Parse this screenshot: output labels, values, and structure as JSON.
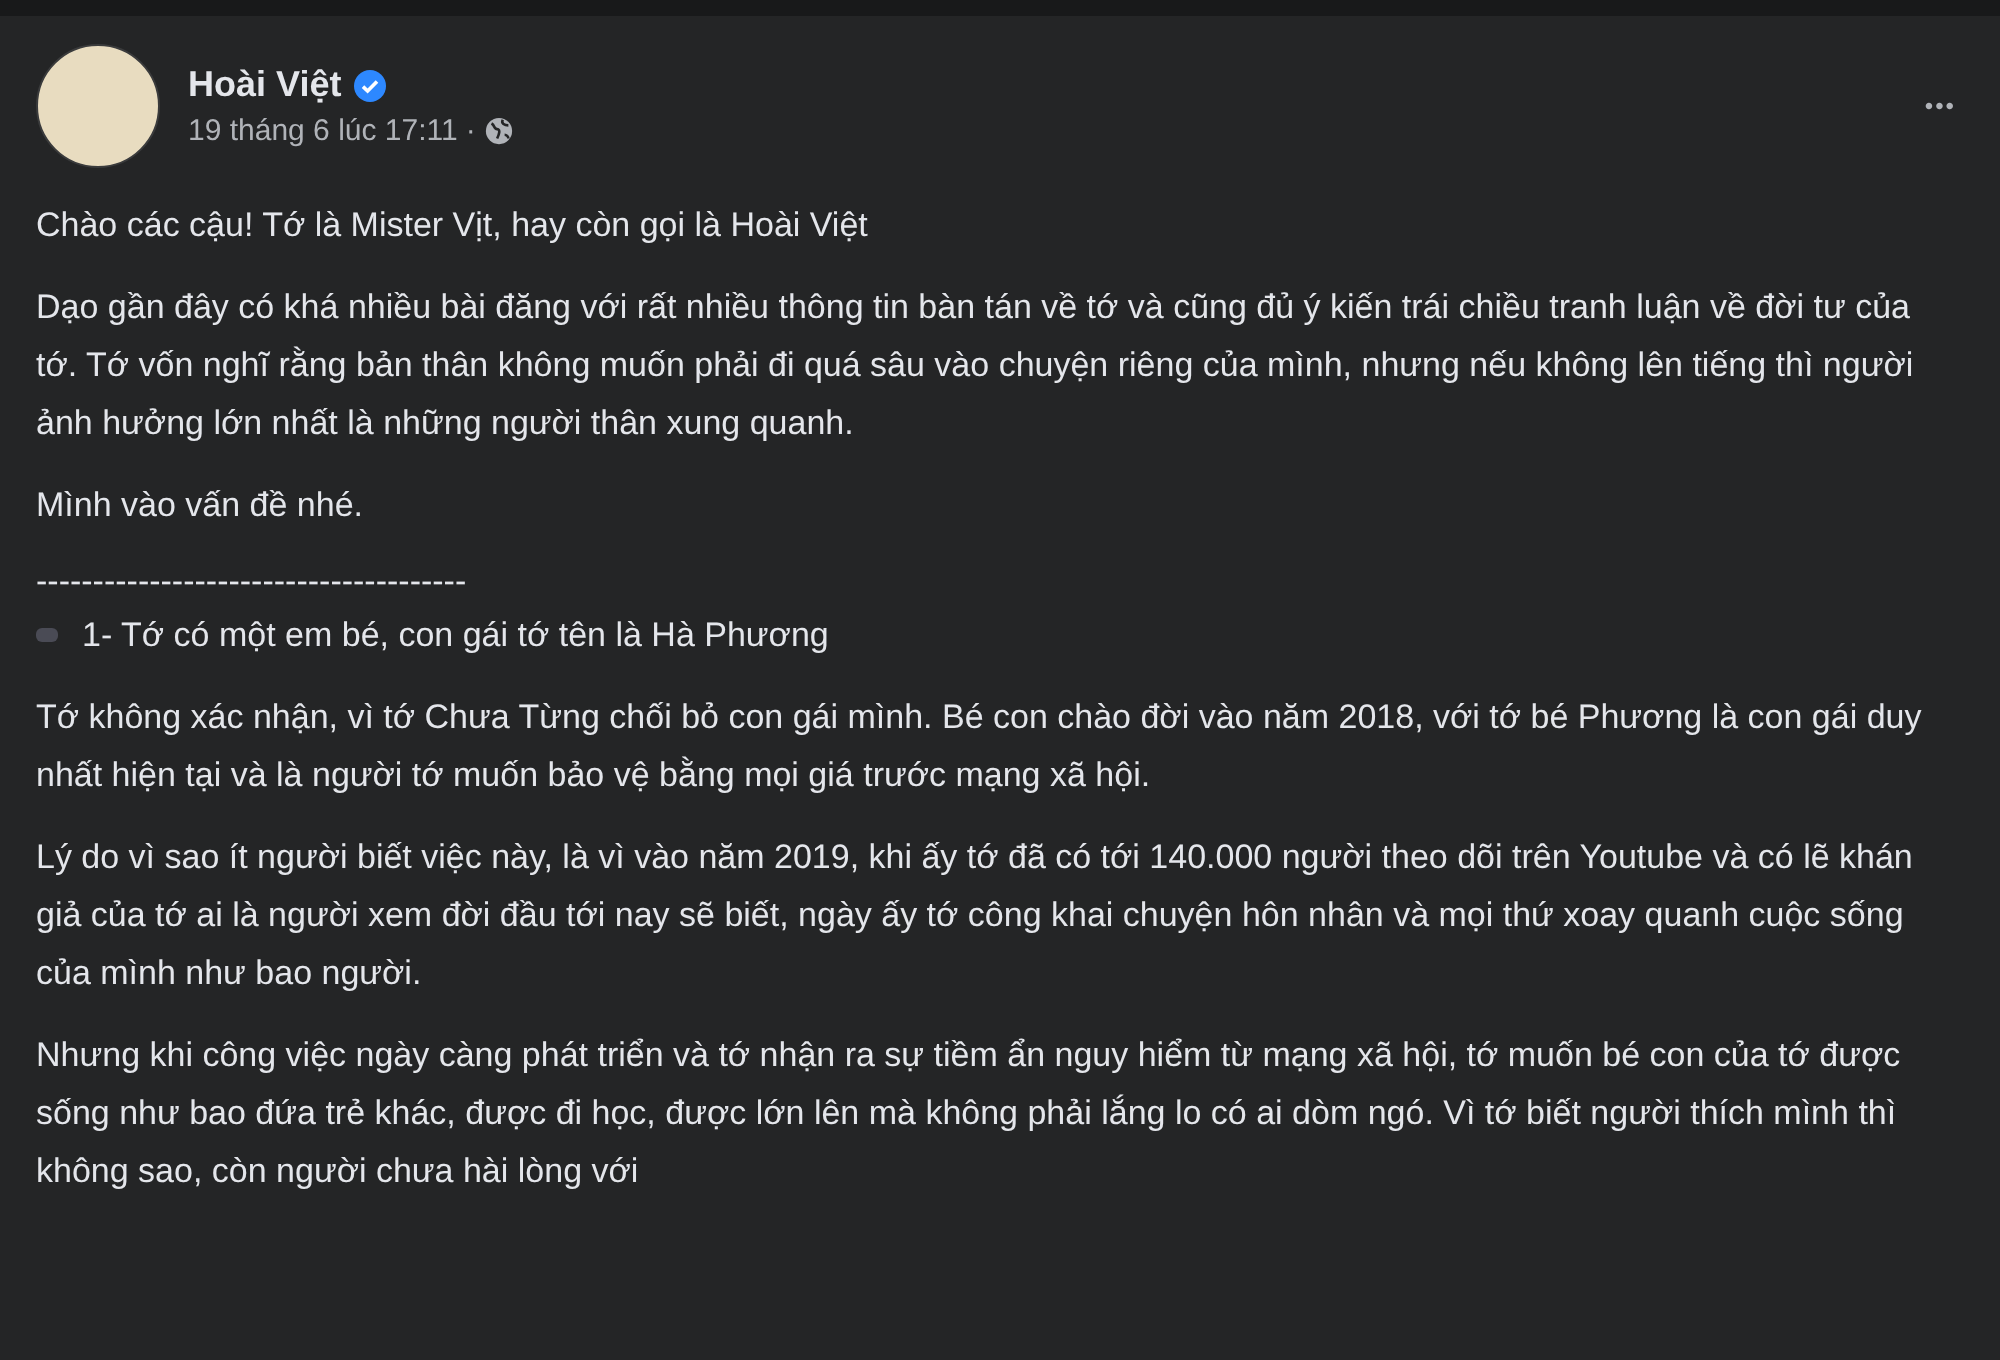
{
  "post": {
    "author": "Hoài Việt",
    "verified": true,
    "timestamp": "19 tháng 6 lúc 17:11",
    "separator": "·",
    "more": "•••",
    "blocks": [
      {
        "kind": "para",
        "text": "Chào các cậu! Tớ là Mister Vịt, hay còn gọi là Hoài Việt"
      },
      {
        "kind": "para",
        "text": "Dạo gần đây có khá nhiều bài đăng với rất nhiều thông tin bàn tán về tớ và cũng đủ ý kiến trái chiều tranh luận về đời tư của tớ. Tớ vốn nghĩ rằng bản thân không muốn phải đi quá sâu vào chuyện riêng của mình, nhưng nếu không lên tiếng thì người ảnh hưởng lớn nhất là những người thân xung quanh."
      },
      {
        "kind": "para",
        "text": "Mình vào vấn đề nhé."
      },
      {
        "kind": "rule",
        "text": "--------------------------------------"
      },
      {
        "kind": "heading",
        "text": "1- Tớ có một em bé, con gái tớ tên là Hà Phương"
      },
      {
        "kind": "para",
        "text": "Tớ không xác nhận, vì tớ Chưa Từng chối bỏ con gái mình. Bé con chào đời vào năm 2018, với tớ bé Phương là con gái duy nhất hiện tại và là người tớ muốn bảo vệ bằng mọi giá trước mạng xã hội."
      },
      {
        "kind": "para",
        "text": "Lý do vì sao ít người biết việc này, là vì vào năm 2019, khi ấy tớ đã có tới 140.000 người theo dõi trên Youtube và có lẽ khán giả của tớ ai là người xem đời đầu tới nay sẽ biết, ngày ấy tớ công khai chuyện hôn nhân và mọi thứ xoay quanh cuộc sống của mình như bao người."
      },
      {
        "kind": "para",
        "text": "Nhưng khi công việc ngày càng phát triển và tớ nhận ra sự tiềm ẩn nguy hiểm từ mạng xã hội, tớ muốn bé con của tớ được sống như bao đứa trẻ khác, được đi học, được lớn lên mà không phải lắng lo có ai dòm ngó. Vì tớ biết người thích mình thì không sao, còn người chưa hài lòng với"
      }
    ]
  }
}
